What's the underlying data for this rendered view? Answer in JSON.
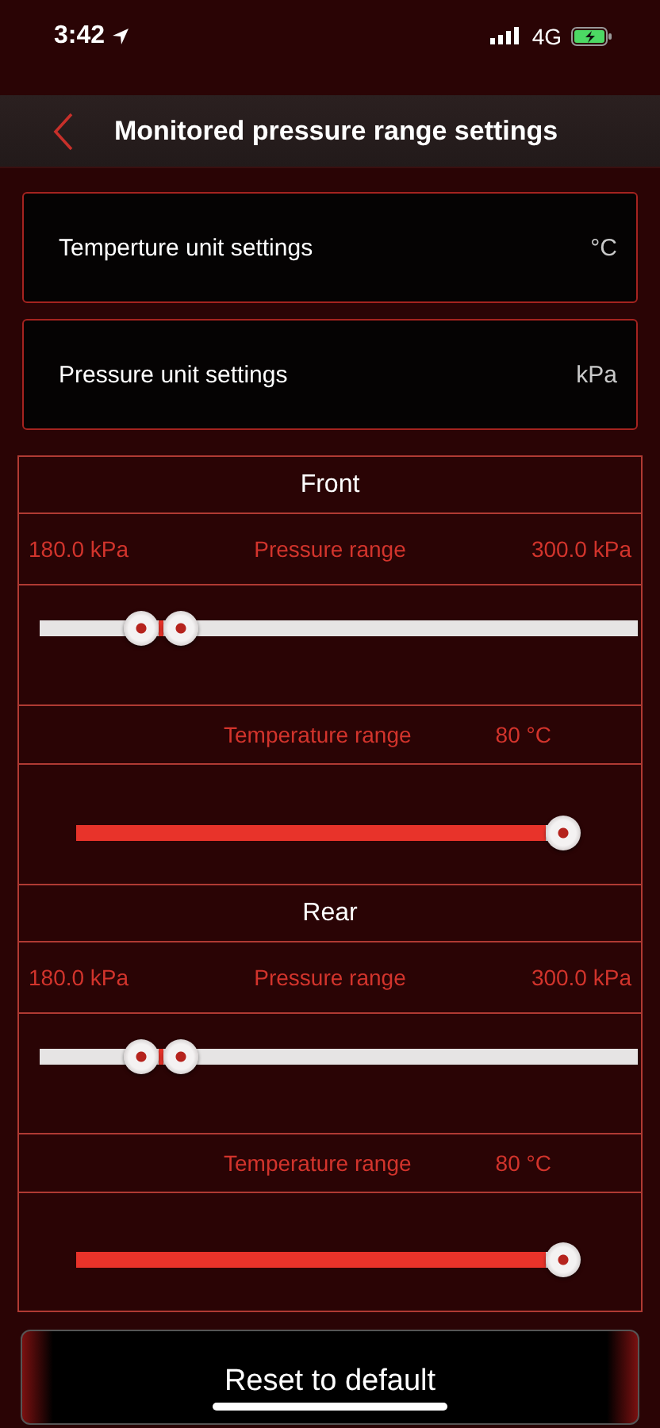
{
  "status_bar": {
    "time": "3:42",
    "network": "4G"
  },
  "header": {
    "title": "Monitored pressure range settings"
  },
  "settings": [
    {
      "label": "Temperture unit settings",
      "value": "°C"
    },
    {
      "label": "Pressure unit settings",
      "value": "kPa"
    }
  ],
  "sections": [
    {
      "title": "Front",
      "pressure": {
        "min": "180.0 kPa",
        "label": "Pressure range",
        "max": "300.0 kPa",
        "thumbs": [
          {
            "level": 0.147
          },
          {
            "level": 0.219
          }
        ]
      },
      "temperature": {
        "label": "Temperature range",
        "value": "80 °C",
        "level": 1
      }
    },
    {
      "title": "Rear",
      "pressure": {
        "min": "180.0 kPa",
        "label": "Pressure range",
        "max": "300.0 kPa",
        "thumbs": [
          {
            "level": 0.147
          },
          {
            "level": 0.219
          }
        ]
      },
      "temperature": {
        "label": "Temperature range",
        "value": "80 °C",
        "level": 1
      }
    }
  ],
  "reset_button": {
    "label": "Reset to default"
  }
}
